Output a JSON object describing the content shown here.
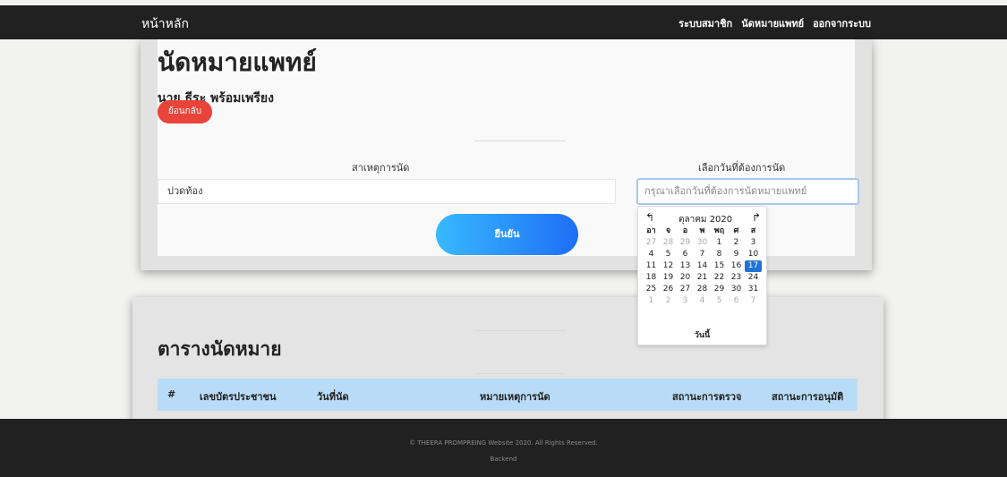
{
  "nav": {
    "brand": "หน้าหลัก",
    "links": [
      "ระบบสมาชิก",
      "นัดหมายแพทย์",
      "ออกจากระบบ"
    ]
  },
  "page": {
    "title": "นัดหมายแพทย์",
    "patient": "นาย ธีระ พร้อมเพรียง",
    "back_label": "ย้อนกลับ"
  },
  "form": {
    "reason_label": "สาเหตุการนัด",
    "reason_value": "ปวดท้อง",
    "date_label": "เลือกวันที่ต้องการนัด",
    "date_placeholder": "กรุณาเลือกวันที่ต้องการนัดหมายแพทย์",
    "confirm_label": "ยืนยัน"
  },
  "calendar": {
    "month_title": "ตุลาคม 2020",
    "weekdays": [
      "อา",
      "จ",
      "อ",
      "พ",
      "พฤ",
      "ศ",
      "ส"
    ],
    "weeks": [
      [
        "27",
        "28",
        "29",
        "30",
        "1",
        "2",
        "3"
      ],
      [
        "4",
        "5",
        "6",
        "7",
        "8",
        "9",
        "10"
      ],
      [
        "11",
        "12",
        "13",
        "14",
        "15",
        "16",
        "17"
      ],
      [
        "18",
        "19",
        "20",
        "21",
        "22",
        "23",
        "24"
      ],
      [
        "25",
        "26",
        "27",
        "28",
        "29",
        "30",
        "31"
      ],
      [
        "1",
        "2",
        "3",
        "4",
        "5",
        "6",
        "7"
      ]
    ],
    "selected_day": "17",
    "today_label": "วันนี้"
  },
  "table": {
    "title": "ตารางนัดหมาย",
    "columns": [
      "#",
      "เลขบัตรประชาชน",
      "วันที่นัด",
      "หมายเหตุการนัด",
      "สถานะการตรวจ",
      "สถานะการอนุมัติ"
    ]
  },
  "footer": {
    "copyright": "© THEERA PROMPREING Website 2020. All Rights Reserved.",
    "backend_link": "Backend"
  }
}
